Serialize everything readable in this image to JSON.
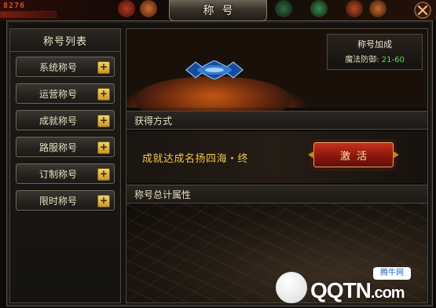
{
  "window": {
    "title": "称号",
    "top_left_readout": "8276"
  },
  "sidebar": {
    "header": "称号列表",
    "items": [
      {
        "label": "系统称号"
      },
      {
        "label": "运营称号"
      },
      {
        "label": "成就称号"
      },
      {
        "label": "路服称号"
      },
      {
        "label": "订制称号"
      },
      {
        "label": "限时称号"
      }
    ]
  },
  "banner": {
    "bonus_title": "称号加成",
    "stat_label": "魔法防御",
    "stat_value": "21-60"
  },
  "acquire": {
    "header": "获得方式",
    "achievement": "成就达成名扬四海・终",
    "activate_label": "激活"
  },
  "attributes": {
    "header": "称号总计属性"
  },
  "watermark": {
    "brand": "QQTN",
    "suffix": ".com",
    "badge": "腾牛网"
  },
  "colors": {
    "gold": "#f0c64e",
    "stat_green": "#4fe24a",
    "button_red": "#8a180d"
  }
}
